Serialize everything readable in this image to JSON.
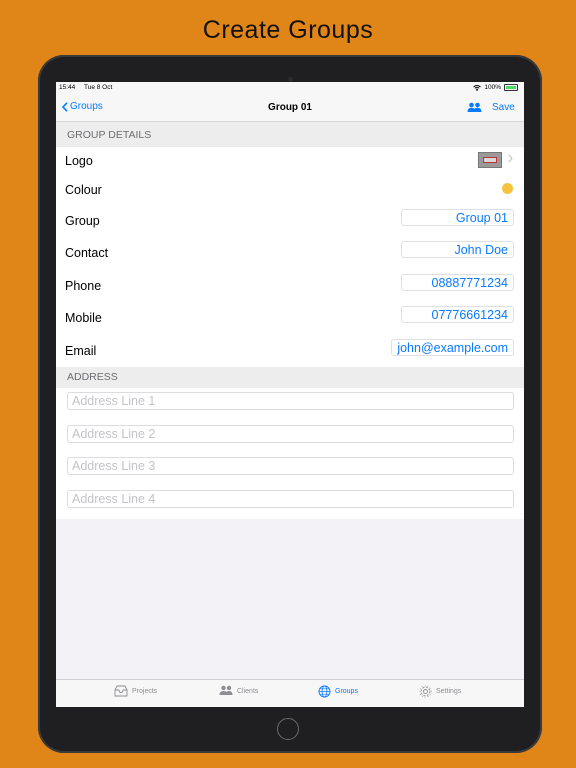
{
  "headline": "Create Groups",
  "status_bar": {
    "time": "15:44",
    "date": "Tue 8 Oct",
    "battery": "100%"
  },
  "nav": {
    "back_label": "Groups",
    "title": "Group 01",
    "save_label": "Save"
  },
  "group_details": {
    "header": "GROUP DETAILS",
    "logo_label": "Logo",
    "colour_label": "Colour",
    "colour_value": "#F7C23C",
    "fields": {
      "group": {
        "label": "Group",
        "value": "Group 01"
      },
      "contact": {
        "label": "Contact",
        "value": "John Doe"
      },
      "phone": {
        "label": "Phone",
        "value": "08887771234"
      },
      "mobile": {
        "label": "Mobile",
        "value": "07776661234"
      },
      "email": {
        "label": "Email",
        "value": "john@example.com"
      }
    }
  },
  "address": {
    "header": "ADDRESS",
    "lines": [
      {
        "placeholder": "Address Line 1",
        "value": ""
      },
      {
        "placeholder": "Address Line 2",
        "value": ""
      },
      {
        "placeholder": "Address Line 3",
        "value": ""
      },
      {
        "placeholder": "Address Line 4",
        "value": ""
      }
    ]
  },
  "tabs": [
    {
      "label": "Projects",
      "icon": "tray-icon",
      "active": false
    },
    {
      "label": "Clients",
      "icon": "people-icon",
      "active": false
    },
    {
      "label": "Groups",
      "icon": "globe-icon",
      "active": true
    },
    {
      "label": "Settings",
      "icon": "gear-icon",
      "active": false
    }
  ],
  "colors": {
    "accent": "#0a7aff",
    "background": "#E08518"
  }
}
